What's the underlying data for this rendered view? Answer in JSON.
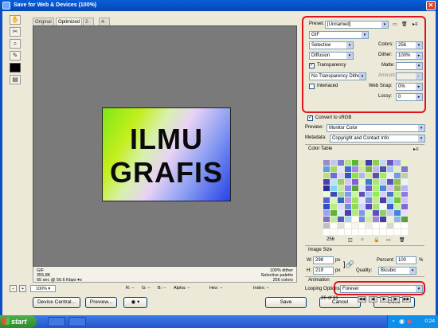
{
  "window": {
    "title": "Save for Web & Devices (100%)"
  },
  "tabs": [
    "Original",
    "Optimized",
    "2-Up",
    "4-Up"
  ],
  "active_tab": "Optimized",
  "artwork": {
    "line1": "ILMU",
    "line2": "GRAFIS"
  },
  "info": {
    "format": "GIF",
    "size": "355,8K",
    "time": "65 sec @ 56.6 Kbps",
    "time_icon": "menu-arrow-icon",
    "dither": "100% dither",
    "palette": "Selective palette",
    "colors": "256 colors"
  },
  "statusbar": {
    "zoom": "100%",
    "r_label": "R:",
    "r_val": "--",
    "g_label": "G:",
    "g_val": "--",
    "b_label": "B:",
    "b_val": "--",
    "alpha_label": "Alpha:",
    "alpha_val": "--",
    "hex_label": "Hex:",
    "hex_val": "--",
    "index_label": "Index:",
    "index_val": "--"
  },
  "buttons": {
    "device_central": "Device Central...",
    "preview": "Preview...",
    "save": "Save",
    "cancel": "Cancel",
    "done": "Done"
  },
  "preset": {
    "label": "Preset:",
    "value": "[Unnamed]",
    "format": "GIF",
    "reduction": "Selective",
    "colors_label": "Colors:",
    "colors_value": "256",
    "dither_algo": "Diffusion",
    "dither_label": "Dither:",
    "dither_value": "100%",
    "transparency_label": "Transparency",
    "matte_label": "Matte:",
    "trans_dither": "No Transparency Dither",
    "amount_label": "Amount:",
    "interlaced_label": "Interlaced",
    "websnap_label": "Web Snap:",
    "websnap_value": "0%",
    "lossy_label": "Lossy:",
    "lossy_value": "0"
  },
  "convert": {
    "label": "Convert to sRGB",
    "preview_label": "Preview:",
    "preview_value": "Monitor Color",
    "metadata_label": "Metadata:",
    "metadata_value": "Copyright and Contact Info"
  },
  "color_table": {
    "title": "Color Table",
    "count": "256",
    "swatches": [
      "#9a8cc4",
      "#c6c6ea",
      "#7d7dc9",
      "#b7e08c",
      "#56b82f",
      "#d9e7a8",
      "#3d3db0",
      "#8fcf4f",
      "#c2d6f6",
      "#6a57c8",
      "#acacf2",
      "#e3f5b7",
      "#5c9fe0",
      "#a4d86d",
      "#e6e1ff",
      "#3c6bd1",
      "#9c8ce8",
      "#cce89c",
      "#7db544",
      "#b8b8ff",
      "#4f4fa7",
      "#9ac7ef",
      "#e0f0c8",
      "#7e74d8",
      "#b1e37b",
      "#6c6cd6",
      "#d7d7ff",
      "#2f58c7",
      "#8be045",
      "#a9b6f0",
      "#c9f08e",
      "#5e4fb7",
      "#94f25a",
      "#e8edff",
      "#6e9de6",
      "#bdd3a2",
      "#4c3fb2",
      "#b8e4ff",
      "#9acf64",
      "#d3c7f7",
      "#7a66d9",
      "#e2f9c1",
      "#3a7bd7",
      "#a2ec6a",
      "#c5cff7",
      "#5854c4",
      "#8ec24d",
      "#f0f0ff",
      "#2b2b9a",
      "#7fd3f7",
      "#c3e9a0",
      "#8c8cec",
      "#5aa63c",
      "#dbe4f9",
      "#6f63cb",
      "#aef070",
      "#4e86dc",
      "#d5c1f4",
      "#93bd63",
      "#b5b5ff",
      "#e6ffd4",
      "#3f49b6",
      "#9fd8a4",
      "#7a9fe4",
      "#c4f7a0",
      "#604cc0",
      "#a7c9f3",
      "#8af248",
      "#d0d0ff",
      "#4d74cb",
      "#baf287",
      "#8e79e4",
      "#5b5bd3",
      "#d8f7b4",
      "#3364c9",
      "#b39be9",
      "#9ee364",
      "#e4e9ff",
      "#7788d4",
      "#c1eb92",
      "#4a3dad",
      "#a5dcf8",
      "#76c443",
      "#cec3f6",
      "#2e4fc0",
      "#b5ef80",
      "#e0d6ff",
      "#6d8ddf",
      "#91da58",
      "#c9d5ff",
      "#5946b9",
      "#a9e07a",
      "#f2f6ff",
      "#3a61cf",
      "#c8f0a4",
      "#8267d6",
      "#a0a0f0",
      "#61b13a",
      "#dcebfd",
      "#4540b0",
      "#b0e98a",
      "#7f98e8",
      "#d3f8bc",
      "#5c50c7",
      "#94cb6c",
      "#c0c7f6",
      "#3c86e0",
      "#e9ddff",
      "#7a71d1",
      "#b9ef94",
      "#4d5fc4",
      "#a5d4f5",
      "#ffffff",
      "#6b8fe0",
      "#cfef9f",
      "#9b85e3",
      "#3f3fa3",
      "#e7f7d6",
      "#8fb3ee",
      "#5a9e40",
      "#c0c0c0",
      "#ffffff",
      "#e0e0e0",
      "#ffffff",
      "#f4f4f4",
      "#ffffff",
      "#ebebeb",
      "#ffffff",
      "#ffffff",
      "#d8d8d8",
      "#ffffff",
      "#ffffff",
      "#ffffff",
      "#ffffff",
      "#ffffff",
      "#ffffff",
      "#ffffff",
      "#ffffff",
      "#ffffff",
      "#ffffff",
      "#ffffff",
      "#ffffff",
      "#ffffff",
      "#ffffff"
    ]
  },
  "image_size": {
    "title": "Image Size",
    "w_label": "W:",
    "w_value": "298",
    "h_label": "H:",
    "h_value": "219",
    "unit": "px",
    "percent_label": "Percent:",
    "percent_value": "100",
    "percent_unit": "%",
    "quality_label": "Quality:",
    "quality_value": "Bicubic"
  },
  "animation": {
    "title": "Animation",
    "looping_label": "Looping Options:",
    "looping_value": "Forever",
    "frame_text": "26 of 31"
  },
  "taskbar": {
    "start": "start",
    "clock": "0:24"
  },
  "accent": {
    "highlight": "#e0141e",
    "titlebar": "#0a5fd8",
    "face": "#ece9d8"
  }
}
